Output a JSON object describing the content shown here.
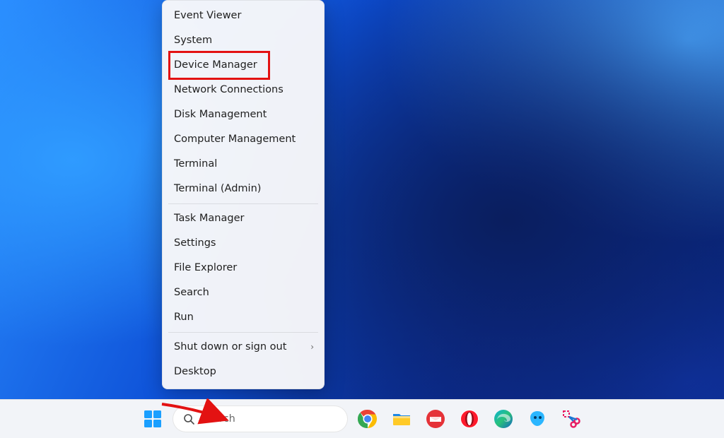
{
  "menu": {
    "items": [
      {
        "label": "Event Viewer"
      },
      {
        "label": "System"
      },
      {
        "label": "Device Manager",
        "highlighted": true
      },
      {
        "label": "Network Connections"
      },
      {
        "label": "Disk Management"
      },
      {
        "label": "Computer Management"
      },
      {
        "label": "Terminal"
      },
      {
        "label": "Terminal (Admin)"
      }
    ],
    "items2": [
      {
        "label": "Task Manager"
      },
      {
        "label": "Settings"
      },
      {
        "label": "File Explorer"
      },
      {
        "label": "Search"
      },
      {
        "label": "Run"
      }
    ],
    "items3": [
      {
        "label": "Shut down or sign out",
        "submenu": true
      },
      {
        "label": "Desktop"
      }
    ]
  },
  "taskbar": {
    "search_placeholder": "Search",
    "icons": [
      {
        "name": "start-icon"
      },
      {
        "name": "search-box"
      },
      {
        "name": "chrome-icon"
      },
      {
        "name": "file-explorer-icon"
      },
      {
        "name": "canada-post-icon"
      },
      {
        "name": "opera-icon"
      },
      {
        "name": "edge-icon"
      },
      {
        "name": "assistant-icon"
      },
      {
        "name": "snipping-tool-icon"
      }
    ]
  },
  "annotation": {
    "arrow_target": "start-button"
  }
}
